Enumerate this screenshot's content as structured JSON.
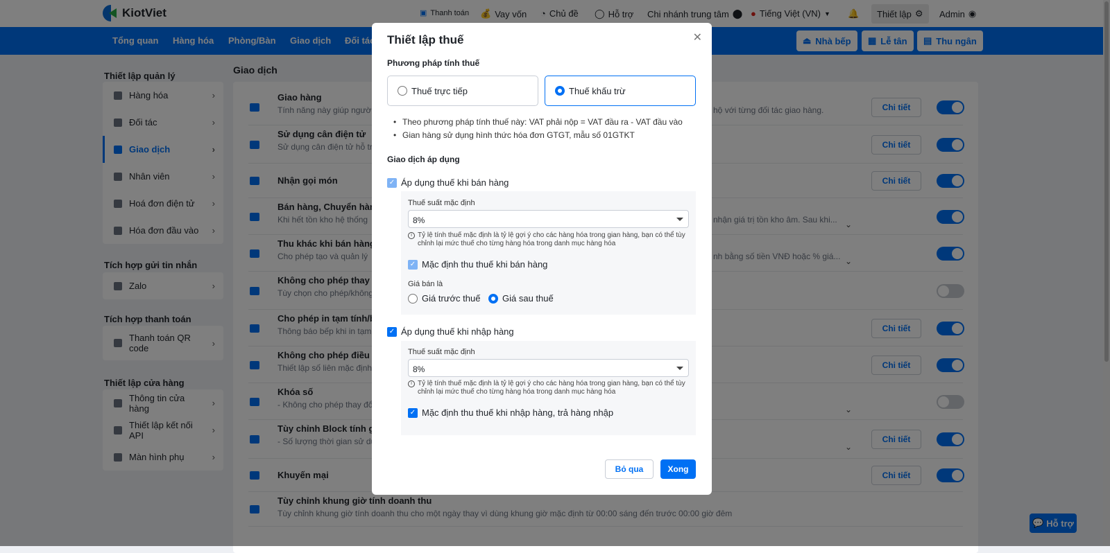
{
  "header": {
    "brand": "KiotViet",
    "links": [
      "Thanh toán",
      "Vay vốn",
      "Chủ đề",
      "Hỗ trợ",
      "Chi nhánh trung tâm",
      "Tiếng Việt (VN)"
    ],
    "settings": "Thiết lập",
    "user": "Admin"
  },
  "nav": {
    "items": [
      "Tổng quan",
      "Hàng hóa",
      "Phòng/Bàn",
      "Giao dịch",
      "Đối tác"
    ],
    "right_buttons": [
      "Nhà bếp",
      "Lễ tân",
      "Thu ngân"
    ]
  },
  "sidebar": {
    "groups": [
      {
        "title": "Thiết lập quản lý",
        "items": [
          "Hàng hóa",
          "Đối tác",
          "Giao dịch",
          "Nhân viên",
          "Hoá đơn điện tử",
          "Hóa đơn đầu vào"
        ]
      },
      {
        "title": "Tích hợp gửi tin nhắn",
        "items": [
          "Zalo"
        ]
      },
      {
        "title": "Tích hợp thanh toán",
        "items": [
          "Thanh toán QR code"
        ]
      },
      {
        "title": "Thiết lập cửa hàng",
        "items": [
          "Thông tin cửa hàng",
          "Thiết lập kết nối API",
          "Màn hình phụ"
        ]
      }
    ],
    "active": "Giao dịch"
  },
  "main": {
    "title": "Giao dịch",
    "detail_label": "Chi tiết",
    "rows": [
      {
        "title": "Giao hàng",
        "desc": "Tính năng này giúp người",
        "desc_right": "u hộ với từng đối tác giao hàng.",
        "detail": true,
        "enabled": true
      },
      {
        "title": "Sử dụng cân điện tử",
        "desc": "Sử dụng cân điện tử hỗ tr",
        "detail": true,
        "enabled": true
      },
      {
        "title": "Nhận gọi món",
        "desc": "",
        "detail": true,
        "enabled": true
      },
      {
        "title": "Bán hàng, Chuyển hàng",
        "desc": "Khi hết tồn kho hệ thống",
        "desc_right": "nhận giá trị tồn kho âm. Sau khi...",
        "detail": false,
        "enabled": true,
        "expand": true
      },
      {
        "title": "Thu khác khi bán hàng",
        "desc": "Cho phép tạo và quản lý",
        "desc_right": "nh bằng số tiền VNĐ hoặc % giá...",
        "detail": false,
        "enabled": true,
        "expand": true
      },
      {
        "title": "Không cho phép thay đ",
        "desc": "Tùy chọn cho phép/không",
        "detail": false,
        "enabled": false
      },
      {
        "title": "Cho phép in tạm tính/b",
        "desc": "Thông báo bếp khi in tạm",
        "detail": true,
        "enabled": true
      },
      {
        "title": "Không cho phép điều c",
        "desc": "Thiết lập số liên mặc định",
        "detail": true,
        "enabled": true
      },
      {
        "title": "Khóa số",
        "desc": "- Không cho phép thay đổ",
        "detail": false,
        "enabled": false,
        "expand": true
      },
      {
        "title": "Tùy chỉnh Block tính gi",
        "desc": "- Số lượng thời gian sử dụ",
        "detail": true,
        "enabled": true,
        "expand": true
      },
      {
        "title": "Khuyến mại",
        "desc": "",
        "detail": true,
        "enabled": true
      },
      {
        "title": "Tùy chỉnh khung giờ tính doanh thu",
        "desc": "Tùy chỉnh khung giờ tính doanh thu cho một ngày thay vì dùng khung giờ mặc định từ 00:00 sáng đến trước 00:00 giờ đêm",
        "detail": false,
        "enabled": null
      }
    ]
  },
  "help_button": "Hỗ trợ",
  "modal": {
    "title": "Thiết lập thuế",
    "method_label": "Phương pháp tính thuế",
    "methods": [
      "Thuế trực tiếp",
      "Thuế khấu trừ"
    ],
    "selected_method": "Thuế khấu trừ",
    "notes": [
      "Theo phương pháp tính thuế này: VAT phải nộp = VAT đầu ra - VAT đầu vào",
      "Gian hàng sử dụng hình thức hóa đơn GTGT, mẫu số 01GTKT"
    ],
    "apply_label": "Giao dịch áp dụng",
    "sale": {
      "label": "Áp dụng thuế khi bán hàng",
      "checked": true,
      "rate_label": "Thuế suất mặc định",
      "rate": "8%",
      "hint": "Tỷ lệ tính thuế mặc định là tỷ lệ gợi ý cho các hàng hóa trong gian hàng, bạn có thể tùy chỉnh lại mức thuế cho từng hàng hóa trong danh mục hàng hóa",
      "default_label": "Mặc định thu thuế khi bán hàng",
      "default_checked": true,
      "price_label": "Giá bán là",
      "price_options": [
        "Giá trước thuế",
        "Giá sau thuế"
      ],
      "price_selected": "Giá sau thuế"
    },
    "purchase": {
      "label": "Áp dụng thuế khi nhập hàng",
      "checked": true,
      "rate_label": "Thuế suất mặc định",
      "rate": "8%",
      "hint": "Tỷ lệ tính thuế mặc định là tỷ lệ gợi ý cho các hàng hóa trong gian hàng, bạn có thể tùy chỉnh lại mức thuế cho từng hàng hóa trong danh mục hàng hóa",
      "default_label": "Mặc định thu thuế khi nhập hàng, trả hàng nhập",
      "default_checked": true
    },
    "cancel": "Bỏ qua",
    "done": "Xong"
  },
  "colors": {
    "primary": "#0070f4",
    "overlay": "rgba(0,0,0,0.5)"
  }
}
